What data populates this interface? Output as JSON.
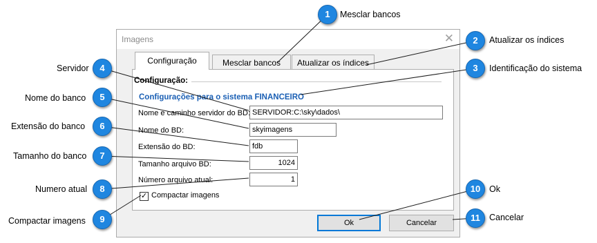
{
  "dialog": {
    "title": "Imagens",
    "close_glyph": "✕",
    "tabs": [
      {
        "label": "Configuração"
      },
      {
        "label": "Mesclar bancos"
      },
      {
        "label": "Atualizar os índices"
      }
    ],
    "section_label": "Configuração:",
    "system_heading": "Configurações para o sistema FINANCEIRO",
    "fields": {
      "server": {
        "label": "Nome e caminho servidor do BD:",
        "value": "SERVIDOR:C:\\sky\\dados\\"
      },
      "db_name": {
        "label": "Nome do BD:",
        "value": "skyimagens"
      },
      "db_ext": {
        "label": "Extensão do BD:",
        "value": "fdb"
      },
      "file_size": {
        "label": "Tamanho arquivo BD:",
        "value": "1024"
      },
      "current_number": {
        "label": "Número arquivo atual:",
        "value": "1"
      }
    },
    "compact": {
      "label": "Compactar imagens",
      "checked": true,
      "check_glyph": "✓"
    },
    "ok_label": "Ok",
    "cancel_label": "Cancelar"
  },
  "callouts": [
    {
      "number": "1",
      "text": "Mesclar bancos"
    },
    {
      "number": "2",
      "text": "Atualizar os índices"
    },
    {
      "number": "3",
      "text": "Identificação do sistema"
    },
    {
      "number": "4",
      "text": "Servidor"
    },
    {
      "number": "5",
      "text": "Nome do banco"
    },
    {
      "number": "6",
      "text": "Extensão do banco"
    },
    {
      "number": "7",
      "text": "Tamanho do banco"
    },
    {
      "number": "8",
      "text": "Numero atual"
    },
    {
      "number": "9",
      "text": "Compactar imagens"
    },
    {
      "number": "10",
      "text": "Ok"
    },
    {
      "number": "11",
      "text": "Cancelar"
    }
  ],
  "colors": {
    "callout_fill": "#1f86e0",
    "heading_blue": "#1a5fb4",
    "dialog_bg": "#f0f0f0"
  }
}
